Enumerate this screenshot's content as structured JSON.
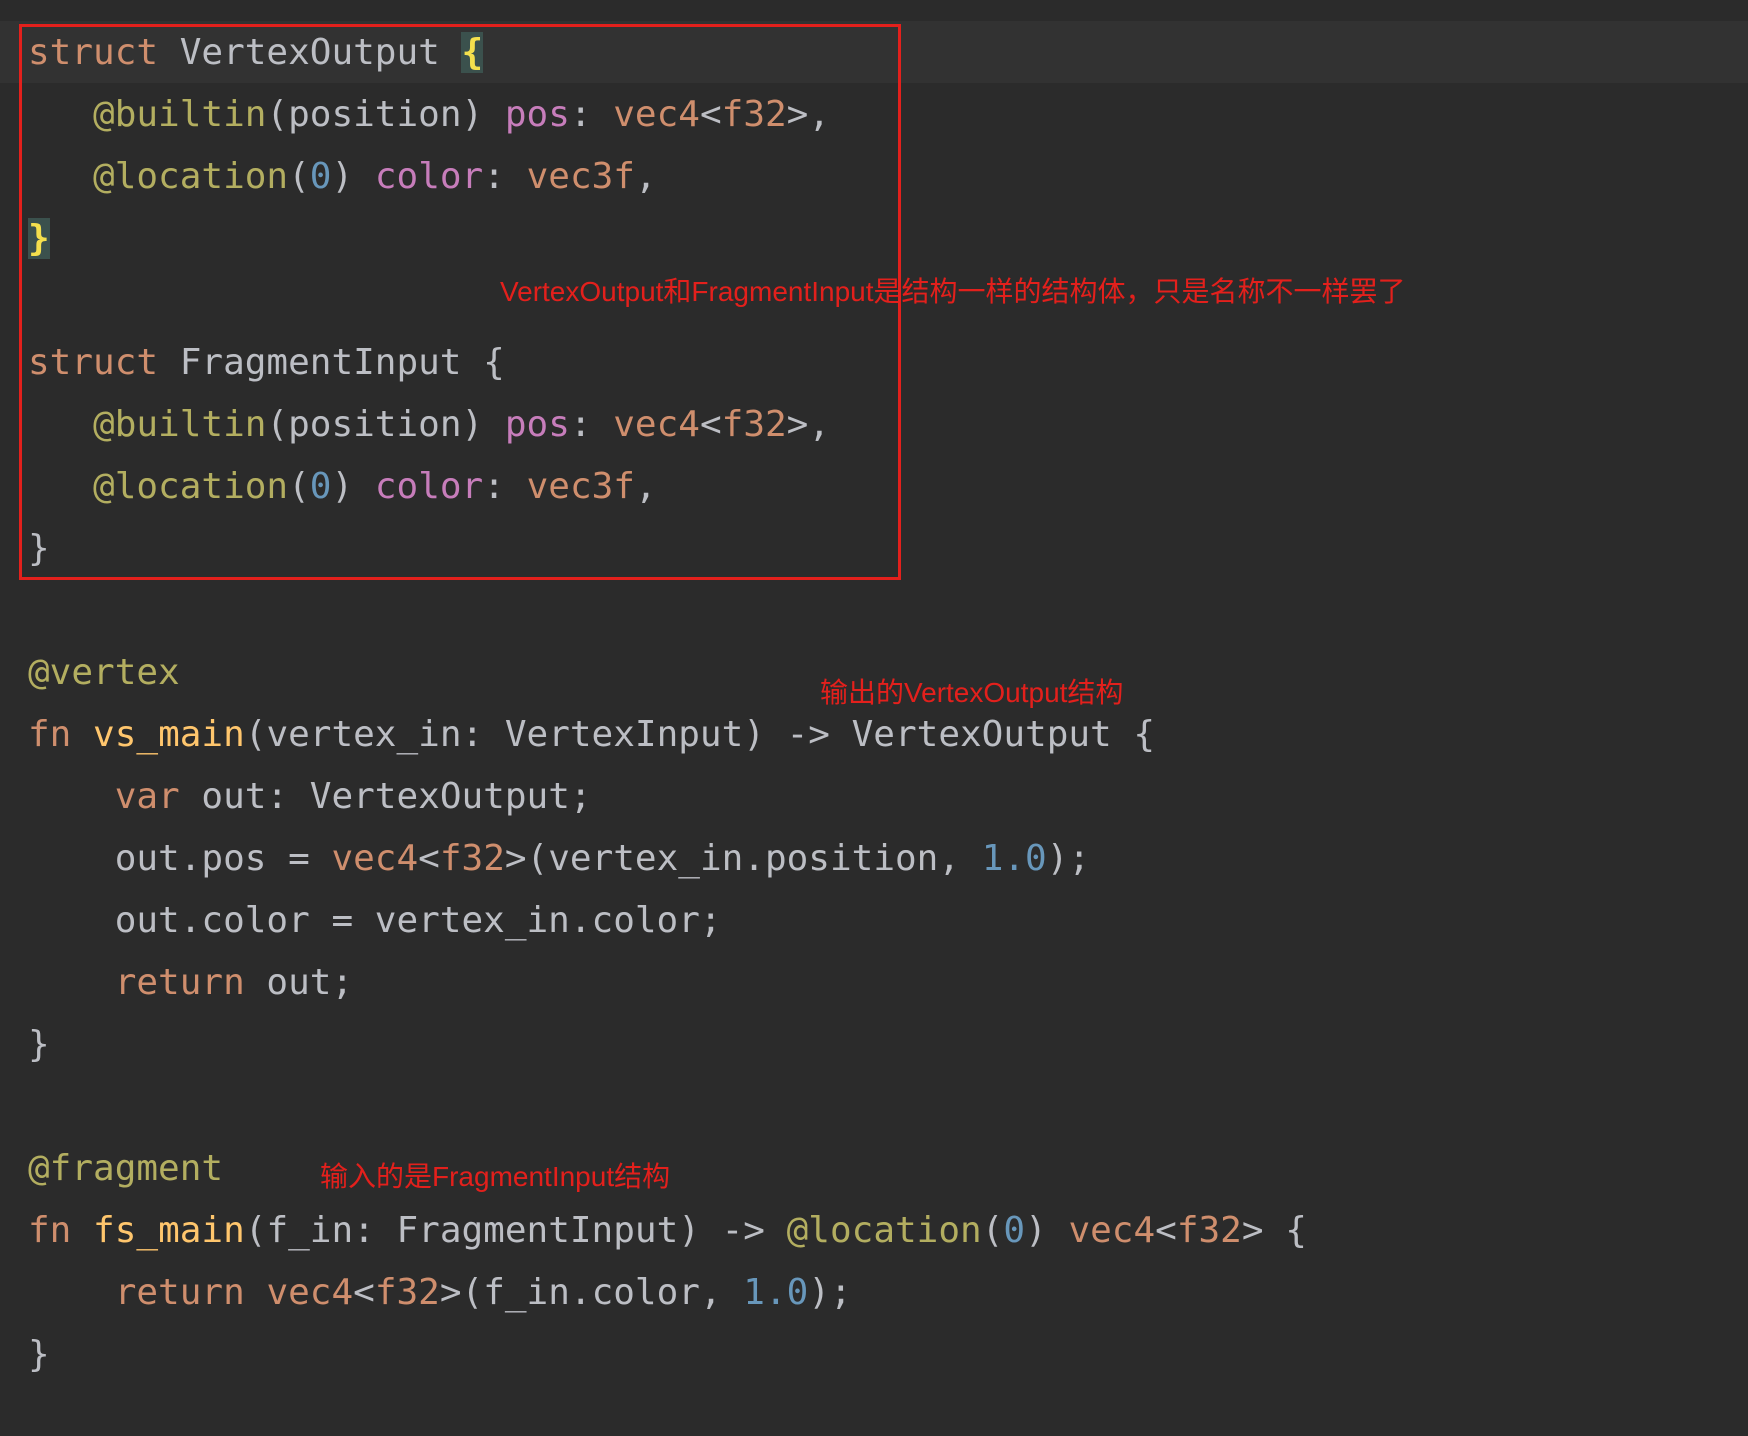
{
  "annotations": {
    "box_note": "VertexOutput和FragmentInput是结构一样的结构体，只是名称不一样罢了",
    "vertex_note": "输出的VertexOutput结构",
    "fragment_note": "输入的是FragmentInput结构"
  },
  "colors": {
    "background": "#2b2b2b",
    "current_line": "#323232",
    "keyword": "#cf8e6d",
    "annotation": "#b3ae60",
    "field": "#c77dbb",
    "number": "#6897bb",
    "function_name": "#ffc66d",
    "default_text": "#bcbec4",
    "matched_brace": "#f4e04d",
    "callout_red": "#e3201c"
  },
  "code": {
    "l1": {
      "kw": "struct",
      "name": " VertexOutput ",
      "brace": "{"
    },
    "l2": {
      "indent": "   ",
      "attr": "@builtin",
      "args": "(position)",
      "sp": " ",
      "field": "pos",
      "colon": ": ",
      "type": "vec4",
      "lt": "<",
      "inner": "f32",
      "tail": ">,"
    },
    "l3": {
      "indent": "   ",
      "attr": "@location",
      "open": "(",
      "num": "0",
      "close": ")",
      "sp": " ",
      "field": "color",
      "colon": ": ",
      "type": "vec3f",
      "tail": ","
    },
    "l4": {
      "brace": "}"
    },
    "l5": {
      "kw": "struct",
      "name": " FragmentInput {"
    },
    "l6": {
      "indent": "   ",
      "attr": "@builtin",
      "args": "(position)",
      "sp": " ",
      "field": "pos",
      "colon": ": ",
      "type": "vec4",
      "lt": "<",
      "inner": "f32",
      "tail": ">,"
    },
    "l7": {
      "indent": "   ",
      "attr": "@location",
      "open": "(",
      "num": "0",
      "close": ")",
      "sp": " ",
      "field": "color",
      "colon": ": ",
      "type": "vec3f",
      "tail": ","
    },
    "l8": {
      "text": "}"
    },
    "l9": {
      "attr": "@vertex"
    },
    "l10": {
      "kw": "fn",
      "sp": " ",
      "fn": "vs_main",
      "rest": "(vertex_in: VertexInput) -> VertexOutput {"
    },
    "l11": {
      "indent": "    ",
      "kw": "var",
      "rest": " out: VertexOutput;"
    },
    "l12": {
      "indent": "    ",
      "lhs": "out.pos = ",
      "type": "vec4",
      "lt": "<",
      "inner": "f32",
      "mid": ">(vertex_in.position, ",
      "num": "1.0",
      "tail": ");"
    },
    "l13": {
      "indent": "    ",
      "text": "out.color = vertex_in.color;"
    },
    "l14": {
      "indent": "    ",
      "kw": "return",
      "rest": " out;"
    },
    "l15": {
      "text": "}"
    },
    "l16": {
      "attr": "@fragment"
    },
    "l17": {
      "kw": "fn",
      "sp": " ",
      "fn": "fs_main",
      "mid": "(f_in: FragmentInput) -> ",
      "attr": "@location",
      "open": "(",
      "num": "0",
      "close": ") ",
      "type": "vec4",
      "lt": "<",
      "inner": "f32",
      "tail": "> {"
    },
    "l18": {
      "indent": "    ",
      "kw": "return",
      "sp": " ",
      "type": "vec4",
      "lt": "<",
      "inner": "f32",
      "mid": ">(f_in.color, ",
      "num": "1.0",
      "tail": ");"
    },
    "l19": {
      "text": "}"
    }
  }
}
